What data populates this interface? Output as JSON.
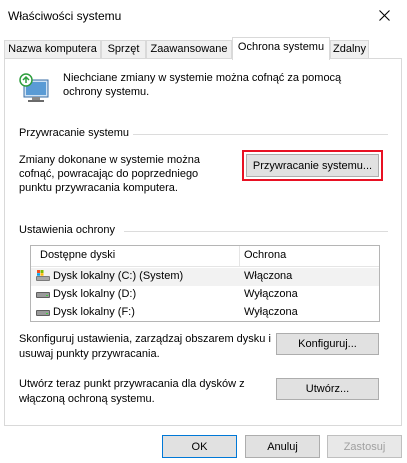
{
  "window": {
    "title": "Właściwości systemu"
  },
  "tabs": [
    {
      "label": "Nazwa komputera",
      "active": false
    },
    {
      "label": "Sprzęt",
      "active": false
    },
    {
      "label": "Zaawansowane",
      "active": false
    },
    {
      "label": "Ochrona systemu",
      "active": true
    },
    {
      "label": "Zdalny",
      "active": false
    }
  ],
  "intro": {
    "icon": "system-protection-icon",
    "text": "Niechciane zmiany w systemie można cofnąć za pomocą ochrony systemu."
  },
  "restore_group": {
    "label": "Przywracanie systemu",
    "description": "Zmiany dokonane w systemie można cofnąć, powracając do poprzedniego punktu przywracania komputera.",
    "button_label": "Przywracanie systemu...",
    "button_highlight_color": "#e81123"
  },
  "protection_group": {
    "label": "Ustawienia ochrony",
    "columns": [
      "Dostępne dyski",
      "Ochrona"
    ],
    "drives": [
      {
        "name": "Dysk lokalny (C:) (System)",
        "status": "Włączona",
        "icon": "system-drive-icon",
        "selected": true
      },
      {
        "name": "Dysk lokalny (D:)",
        "status": "Wyłączona",
        "icon": "drive-icon",
        "selected": false
      },
      {
        "name": "Dysk lokalny (F:)",
        "status": "Wyłączona",
        "icon": "drive-icon",
        "selected": false
      }
    ],
    "configure_text": "Skonfiguruj ustawienia, zarządzaj obszarem dysku i usuwaj punkty przywracania.",
    "configure_button": "Konfiguruj...",
    "create_text": "Utwórz teraz punkt przywracania dla dysków z włączoną ochroną systemu.",
    "create_button": "Utwórz..."
  },
  "footer": {
    "ok": "OK",
    "cancel": "Anuluj",
    "apply": "Zastosuj"
  }
}
